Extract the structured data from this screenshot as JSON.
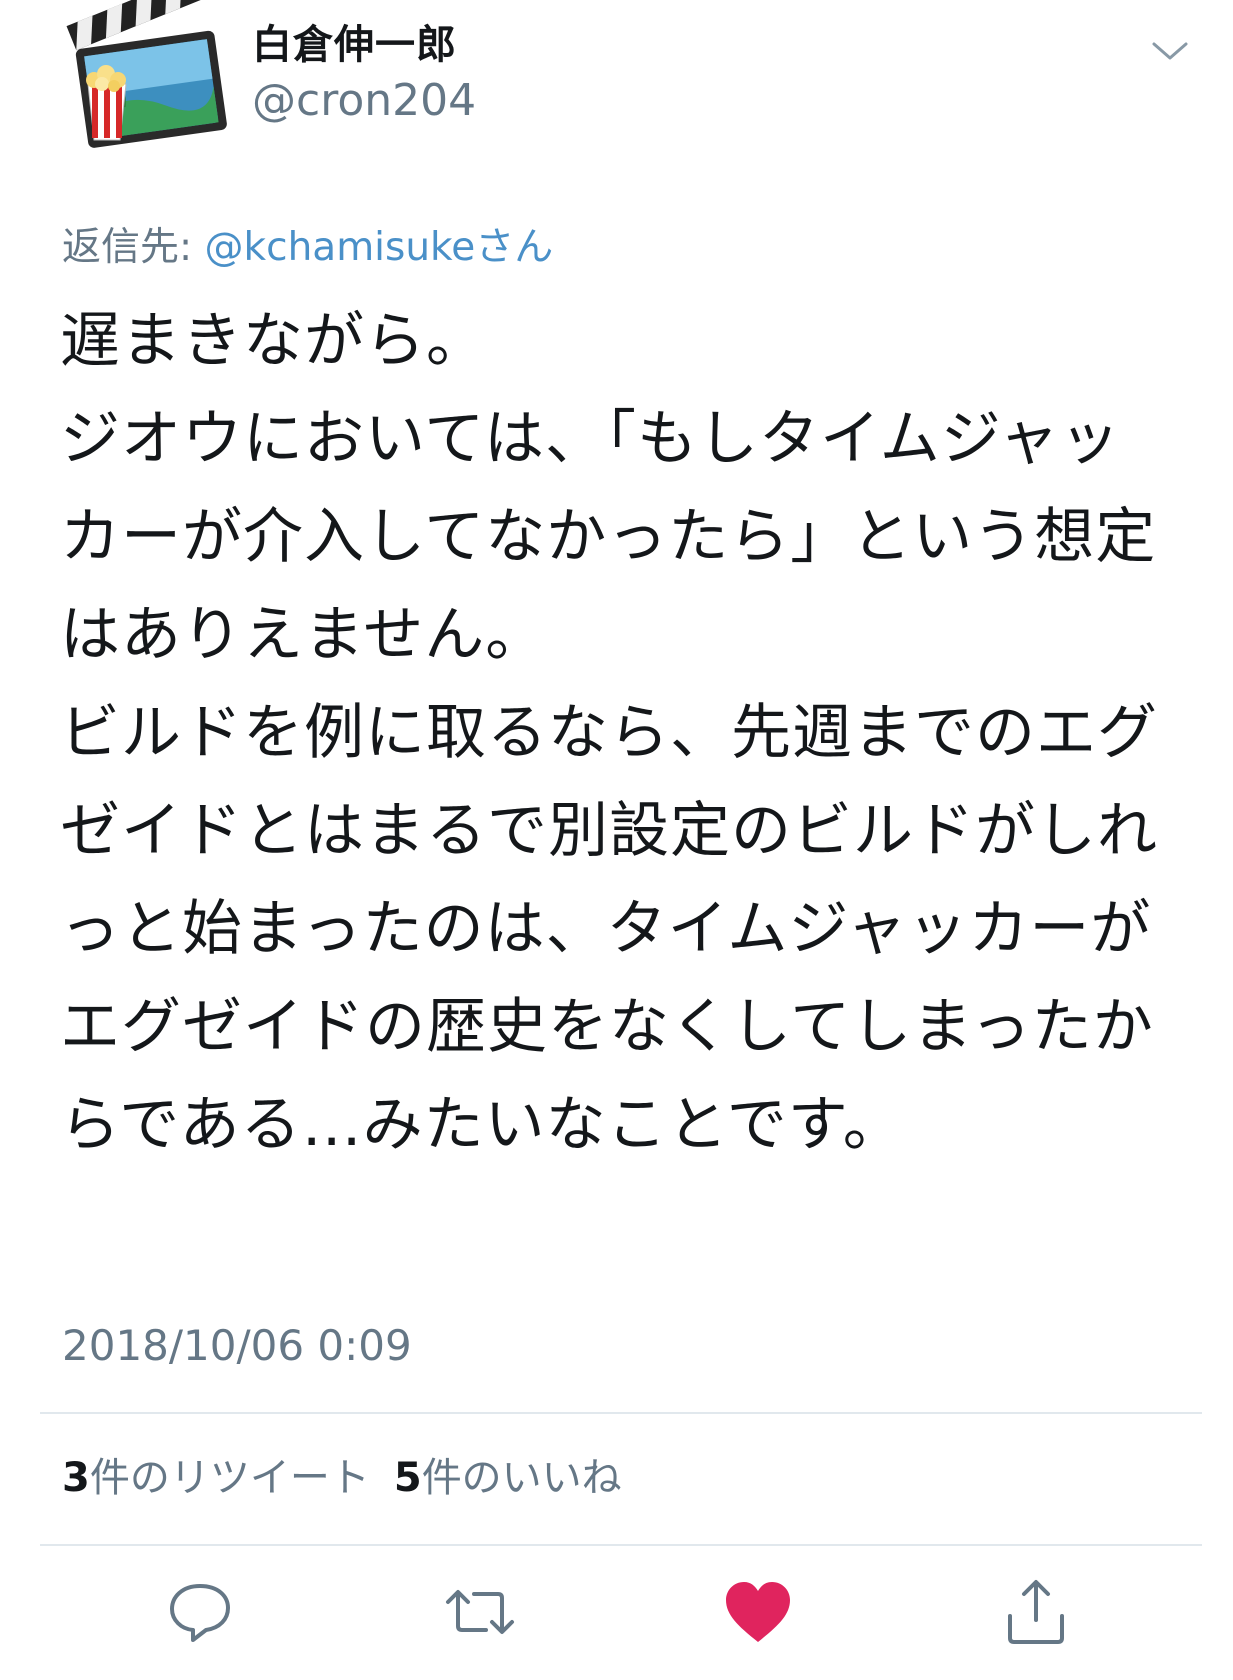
{
  "author": {
    "display_name": "白倉伸一郎",
    "handle": "@cron204"
  },
  "reply_to": {
    "prefix": "返信先: ",
    "mention": "@kchamisuke",
    "suffix": "さん"
  },
  "tweet": {
    "paragraph1": "遅まきながら。",
    "paragraph2": "ジオウにおいては、「もしタイムジャッカーが介入してなかったら」という想定はありえません。\nビルドを例に取るなら、先週までのエグゼイドとはまるで別設定のビルドがしれっと始まったのは、タイムジャッカーがエグゼイドの歴史をなくしてしまったからである…みたいなことです。",
    "timestamp": "2018/10/06 0:09"
  },
  "stats": {
    "retweets_count": "3",
    "retweets_label": "件のリツイート",
    "likes_count": "5",
    "likes_label": "件のいいね"
  },
  "icons": {
    "menu": "chevron-down-icon",
    "reply": "reply-icon",
    "retweet": "retweet-icon",
    "like": "heart-icon",
    "share": "share-icon"
  },
  "colors": {
    "text": "#14171a",
    "secondary": "#657786",
    "link": "#4a90c8",
    "like": "#e0245e",
    "divider": "#e1e8ed"
  }
}
